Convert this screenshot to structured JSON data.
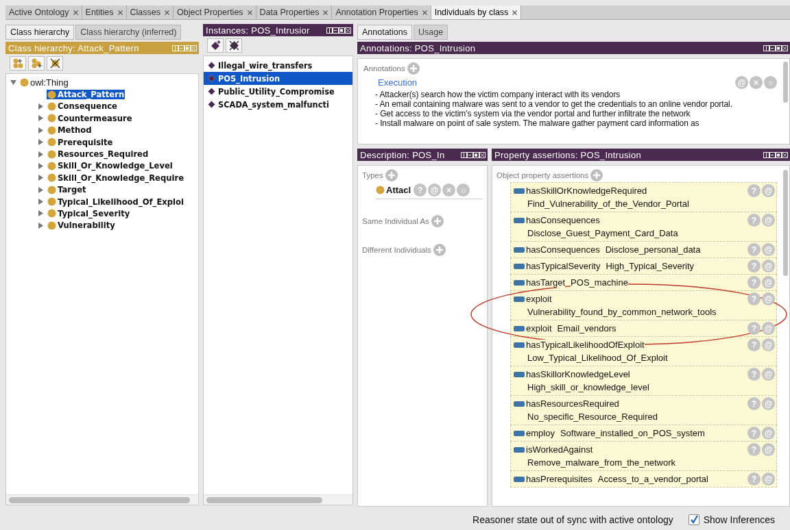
{
  "tabs": [
    {
      "label": "Active Ontology",
      "selected": false
    },
    {
      "label": "Entities",
      "selected": false
    },
    {
      "label": "Classes",
      "selected": false
    },
    {
      "label": "Object Properties",
      "selected": false
    },
    {
      "label": "Data Properties",
      "selected": false
    },
    {
      "label": "Annotation Properties",
      "selected": false
    },
    {
      "label": "Individuals by class",
      "selected": true
    }
  ],
  "class_panel": {
    "tabs": [
      {
        "label": "Class hierarchy",
        "selected": true
      },
      {
        "label": "Class hierarchy (inferred)",
        "selected": false
      }
    ],
    "header": "Class hierarchy: Attack_Pattern",
    "tree": [
      {
        "label": "owl:Thing",
        "bold": false,
        "selected": false,
        "expanded": true,
        "children": [
          {
            "label": "Attack_Pattern",
            "bold": true,
            "selected": true
          },
          {
            "label": "Consequence",
            "bold": true,
            "selected": false,
            "expanded": false
          },
          {
            "label": "Countermeasure",
            "bold": true,
            "selected": false,
            "expanded": false
          },
          {
            "label": "Method",
            "bold": true,
            "selected": false,
            "expanded": false
          },
          {
            "label": "Prerequisite",
            "bold": true,
            "selected": false,
            "expanded": false
          },
          {
            "label": "Resources_Required",
            "bold": true,
            "selected": false,
            "expanded": false
          },
          {
            "label": "Skill_Or_Knowledge_Level",
            "bold": true,
            "selected": false,
            "expanded": false
          },
          {
            "label": "Skill_Or_Knowledge_Require",
            "bold": true,
            "selected": false,
            "expanded": false
          },
          {
            "label": "Target",
            "bold": true,
            "selected": false,
            "expanded": false
          },
          {
            "label": "Typical_Likelihood_Of_Exploi",
            "bold": true,
            "selected": false,
            "expanded": false
          },
          {
            "label": "Typical_Severity",
            "bold": true,
            "selected": false,
            "expanded": false
          },
          {
            "label": "Vulnerability",
            "bold": true,
            "selected": false,
            "expanded": false
          }
        ]
      }
    ]
  },
  "instances_panel": {
    "header": "Instances: POS_Intrusior",
    "items": [
      {
        "label": "Illegal_wire_transfers",
        "selected": false
      },
      {
        "label": "POS_Intrusion",
        "selected": true
      },
      {
        "label": "Public_Utility_Compromise",
        "selected": false
      },
      {
        "label": "SCADA_system_malfuncti",
        "selected": false
      }
    ]
  },
  "right_tabs": [
    {
      "label": "Annotations",
      "selected": true
    },
    {
      "label": "Usage",
      "selected": false
    }
  ],
  "annotations": {
    "header": "Annotations: POS_Intrusion",
    "section_label": "Annotations",
    "items": [
      {
        "property": "Execution",
        "buttons": [
          "@",
          "×",
          "○"
        ],
        "lines": [
          "- Attacker(s) search how the victim company interact with its vendors",
          "- An email containing malware was sent to a vendor to get the credentials to an online vendor portal.",
          "- Get access to the victim’s system via the vendor portal and further infiltrate the network",
          "- Install malware on point of sale system. The malware gather payment card information as"
        ]
      }
    ]
  },
  "description": {
    "header": "Description: POS_In",
    "sections": [
      {
        "label": "Types",
        "items": [
          {
            "label": "Attacl",
            "buttons": [
              "?",
              "@",
              "×",
              "○"
            ]
          }
        ]
      },
      {
        "label": "Same Individual As"
      },
      {
        "label": "Different Individuals"
      }
    ]
  },
  "property_assertions": {
    "header": "Property assertions: POS_Intrusion",
    "section_label": "Object property assertions",
    "rows": [
      {
        "kind": "stacked",
        "property": "hasSkillOrKnowledgeRequired",
        "value": "Find_Vulnerability_of_the_Vendor_Portal",
        "buttons": [
          "?",
          "@"
        ]
      },
      {
        "kind": "stacked",
        "property": "hasConsequences",
        "value": "Disclose_Guest_Payment_Card_Data",
        "buttons": [
          "?",
          "@"
        ]
      },
      {
        "kind": "inline",
        "property": "hasConsequences",
        "value": "Disclose_personal_data",
        "buttons": [
          "?",
          "@"
        ]
      },
      {
        "kind": "inline",
        "property": "hasTypicalSeverity",
        "value": "High_Typical_Severity",
        "buttons": [
          "?",
          "@"
        ]
      },
      {
        "kind": "inline",
        "property": "hasTarget",
        "value": "POS_machine",
        "buttons": [
          "?",
          "@"
        ]
      },
      {
        "kind": "stacked",
        "property": "exploit",
        "value": "Vulnerability_found_by_common_network_tools",
        "buttons": [
          "?",
          "@"
        ]
      },
      {
        "kind": "inline",
        "property": "exploit",
        "value": "Email_vendors",
        "buttons": [
          "?",
          "@"
        ]
      },
      {
        "kind": "stacked",
        "property": "hasTypicalLikelihoodOfExploit",
        "value": "Low_Typical_Likelihood_Of_Exploit",
        "buttons": [
          "?",
          "@"
        ]
      },
      {
        "kind": "stacked",
        "property": "hasSkillorKnowledgeLevel",
        "value": "High_skill_or_knowledge_level",
        "buttons": [
          "?",
          "@"
        ]
      },
      {
        "kind": "stacked",
        "property": "hasResourcesRequired",
        "value": "No_specific_Resource_Required",
        "buttons": [
          "?",
          "@"
        ]
      },
      {
        "kind": "inline",
        "property": "employ",
        "value": "Software_installed_on_POS_system",
        "buttons": [
          "?",
          "@"
        ]
      },
      {
        "kind": "stacked",
        "property": "isWorkedAgainst",
        "value": "Remove_malware_from_the_network",
        "buttons": [
          "?",
          "@"
        ]
      },
      {
        "kind": "inline",
        "property": "hasPrerequisites",
        "value": "Access_to_a_vendor_portal",
        "buttons": [
          "?",
          "@"
        ]
      }
    ]
  },
  "status_bar": {
    "message": "Reasoner state out of sync with active ontology",
    "show_inferences": {
      "label": "Show Inferences",
      "checked": true
    }
  }
}
